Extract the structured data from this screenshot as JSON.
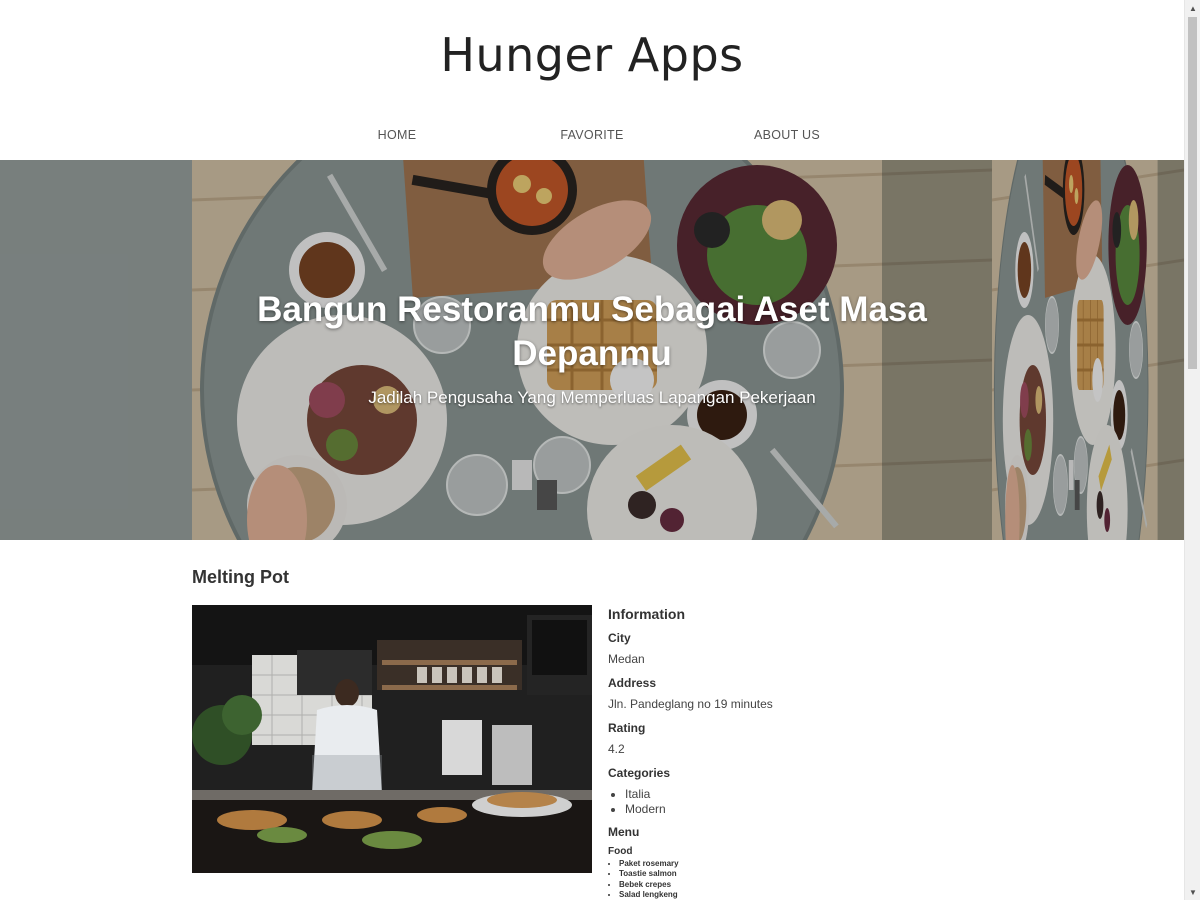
{
  "header": {
    "title": "Hunger Apps"
  },
  "nav": {
    "items": [
      {
        "label": "HOME"
      },
      {
        "label": "FAVORITE"
      },
      {
        "label": "ABOUT US"
      }
    ]
  },
  "hero": {
    "title": "Bangun Restoranmu Sebagai Aset Masa Depanmu",
    "subtitle": "Jadilah Pengusaha Yang Memperluas Lapangan Pekerjaan"
  },
  "restaurant": {
    "name": "Melting Pot",
    "info_heading": "Information",
    "city_label": "City",
    "city": "Medan",
    "address_label": "Address",
    "address": "Jln. Pandeglang no 19 minutes",
    "rating_label": "Rating",
    "rating": "4.2",
    "categories_label": "Categories",
    "categories": [
      "Italia",
      "Modern"
    ],
    "menu_label": "Menu",
    "food_label": "Food",
    "foods": [
      "Paket rosemary",
      "Toastie salmon",
      "Bebek crepes",
      "Salad lengkeng"
    ]
  },
  "colors": {
    "text": "#333333",
    "nav_text": "#555555",
    "hero_text": "#ffffff"
  }
}
